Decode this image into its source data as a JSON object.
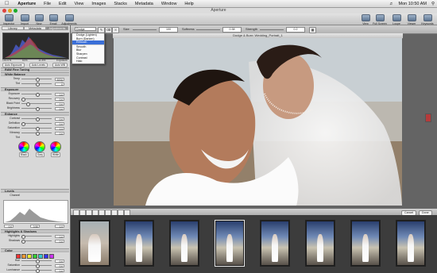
{
  "menubar": {
    "app": "Aperture",
    "items": [
      "File",
      "Edit",
      "View",
      "Images",
      "Stacks",
      "Metadata",
      "Window",
      "Help"
    ],
    "clock": "Mon 10:50 AM"
  },
  "window": {
    "title": "Aperture"
  },
  "toolbar": {
    "left": [
      "Inspector",
      "Import",
      "New",
      "Email",
      "Adjustments"
    ],
    "right": [
      "View",
      "Full Screen",
      "Loupe",
      "Viewer",
      "Keywords"
    ]
  },
  "inspector": {
    "tabs": [
      "Library",
      "Metadata",
      "Adjustments"
    ],
    "active_tab": "Adjustments",
    "histogram_labels": [
      "100.0%",
      "50%",
      "11.8%",
      "Exposure"
    ],
    "buttons": [
      "Auto Exposure",
      "Auto Levels",
      "Auto WB"
    ],
    "sections": {
      "raw": "RAW Fine Tuning",
      "white_balance": "White Balance",
      "exposure": "Exposure",
      "enhance": "Enhance",
      "levels": "Levels",
      "highlights": "Highlights & Shadows",
      "color": "Color"
    },
    "white_balance_rows": [
      {
        "label": "Temp",
        "value": "5700 K"
      },
      {
        "label": "Tint",
        "value": "0"
      }
    ],
    "exposure_rows": [
      {
        "label": "Exposure",
        "value": "0.0"
      },
      {
        "label": "Recovery",
        "value": "0.0"
      },
      {
        "label": "Black Point",
        "value": "0.0"
      },
      {
        "label": "Brightness",
        "value": "0.0"
      }
    ],
    "enhance_rows": [
      {
        "label": "Contrast",
        "value": "0.0"
      },
      {
        "label": "Definition",
        "value": "0.0"
      },
      {
        "label": "Saturation",
        "value": "1.0"
      },
      {
        "label": "Vibrancy",
        "value": "0.0"
      }
    ],
    "tint_label": "Tint",
    "wheels": [
      "Black",
      "Gray",
      "White"
    ],
    "levels_channel": "Channel",
    "levels_values": [
      "0.0",
      "0.50",
      "1.0"
    ],
    "highlight_rows": [
      {
        "label": "Highlights",
        "value": "0.0"
      },
      {
        "label": "Shadows",
        "value": "0.0"
      }
    ],
    "color_rows": [
      {
        "label": "Hue",
        "value": "0.0"
      },
      {
        "label": "Saturation",
        "value": "0.0"
      },
      {
        "label": "Luminance",
        "value": "0.0"
      },
      {
        "label": "Range",
        "value": "1.0"
      }
    ],
    "swatch_colors": [
      "#e33",
      "#e93",
      "#ee3",
      "#3c3",
      "#3cc",
      "#33e",
      "#c3e"
    ]
  },
  "viewer": {
    "brush_dropdown": "Dodge (Lighten)",
    "brush_menu": [
      "Dodge (Lighten)",
      "Burn (Darken)",
      "Retouch",
      "Smooth",
      "Blur",
      "Sharpen",
      "Contrast",
      "Halo"
    ],
    "brush_menu_selected": "Retouch",
    "size_label": "Size",
    "size_value": "100",
    "softness_label": "Softness",
    "softness_value": "0.38",
    "strength_label": "Strength",
    "strength_value": "0.2",
    "image_title": "Dodge & Burn: Wedding_Portrait_1",
    "cancel": "Cancel",
    "done": "Done"
  },
  "filmstrip": {
    "count": 8,
    "selected_index": 3
  }
}
